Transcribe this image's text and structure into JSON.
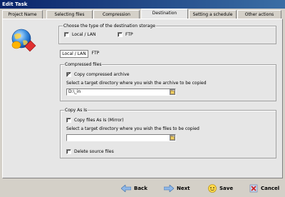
{
  "window": {
    "title": "Edit Task"
  },
  "tabs": [
    {
      "label": "Project Name"
    },
    {
      "label": "Selecting files"
    },
    {
      "label": "Compression"
    },
    {
      "label": "Destination"
    },
    {
      "label": "Setting a schedule"
    },
    {
      "label": "Other actions"
    }
  ],
  "storage": {
    "group_title": "Choose the type of the destination storage",
    "local_label": "Local / LAN",
    "ftp_label": "FTP"
  },
  "subtabs": [
    {
      "label": "Local / LAN"
    },
    {
      "label": "FTP"
    }
  ],
  "compressed": {
    "group_title": "Compressed files",
    "copy_label": "Copy compressed archive",
    "dir_label": "Select a target directory where you wish the archive to be copied",
    "dir_value": "D:\\_in"
  },
  "copyasis": {
    "group_title": "Copy As Is",
    "mirror_label": "Copy files As Is (Mirror)",
    "dir_label": "Select a target directory where you wish the files to be copied",
    "dir_value": "",
    "delete_label": "Delete source files"
  },
  "footer": {
    "back_label": "Back",
    "next_label": "Next",
    "save_label": "Save",
    "cancel_label": "Cancel"
  },
  "state": {
    "active_tab": "Destination",
    "local_checked": false,
    "ftp_checked": false,
    "copy_checked": true,
    "mirror_checked": false,
    "delete_checked": false
  },
  "icons": {
    "main": "globe-disk-icon",
    "back": "back-arrow-icon",
    "next": "next-arrow-icon",
    "save": "save-icon",
    "cancel": "cancel-icon"
  },
  "colors": {
    "title_bar": "#0a246a",
    "panel": "#e6e6e6",
    "chrome": "#d4d0c8"
  }
}
